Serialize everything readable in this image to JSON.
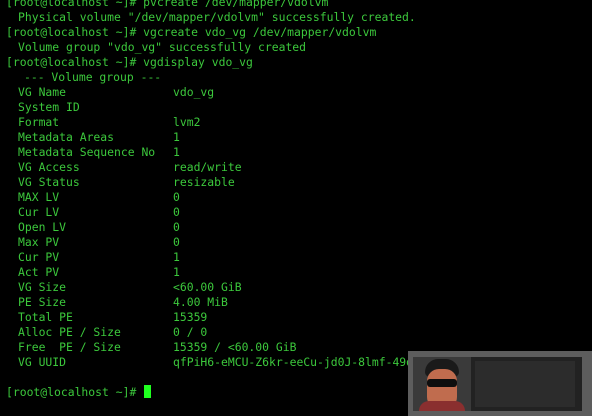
{
  "terminal": {
    "prompt": "[root@localhost ~]# ",
    "lines": [
      {
        "type": "cmd",
        "text": "pvcreate /dev/mapper/vdolvm"
      },
      {
        "type": "out",
        "text": "Physical volume \"/dev/mapper/vdolvm\" successfully created."
      },
      {
        "type": "cmd",
        "text": "vgcreate vdo_vg /dev/mapper/vdolvm"
      },
      {
        "type": "out",
        "text": "Volume group \"vdo_vg\" successfully created"
      },
      {
        "type": "cmd",
        "text": "vgdisplay vdo_vg"
      },
      {
        "type": "header",
        "text": "--- Volume group ---"
      }
    ],
    "vg_fields": [
      {
        "key": "VG Name",
        "value": "vdo_vg"
      },
      {
        "key": "System ID",
        "value": ""
      },
      {
        "key": "Format",
        "value": "lvm2"
      },
      {
        "key": "Metadata Areas",
        "value": "1"
      },
      {
        "key": "Metadata Sequence No",
        "value": "1"
      },
      {
        "key": "VG Access",
        "value": "read/write"
      },
      {
        "key": "VG Status",
        "value": "resizable"
      },
      {
        "key": "MAX LV",
        "value": "0"
      },
      {
        "key": "Cur LV",
        "value": "0"
      },
      {
        "key": "Open LV",
        "value": "0"
      },
      {
        "key": "Max PV",
        "value": "0"
      },
      {
        "key": "Cur PV",
        "value": "1"
      },
      {
        "key": "Act PV",
        "value": "1"
      },
      {
        "key": "VG Size",
        "value": "<60.00 GiB"
      },
      {
        "key": "PE Size",
        "value": "4.00 MiB"
      },
      {
        "key": "Total PE",
        "value": "15359"
      },
      {
        "key": "Alloc PE / Size",
        "value": "0 / 0"
      },
      {
        "key": "Free  PE / Size",
        "value": "15359 / <60.00 GiB"
      },
      {
        "key": "VG UUID",
        "value": "qfPiH6-eMCU-Z6kr-eeCu-jd0J-8lmf-49daZX"
      }
    ],
    "final_prompt": "[root@localhost ~]# ",
    "colors": {
      "background": "#000000",
      "text": "#3cc83c",
      "cursor": "#1fff1f"
    }
  }
}
